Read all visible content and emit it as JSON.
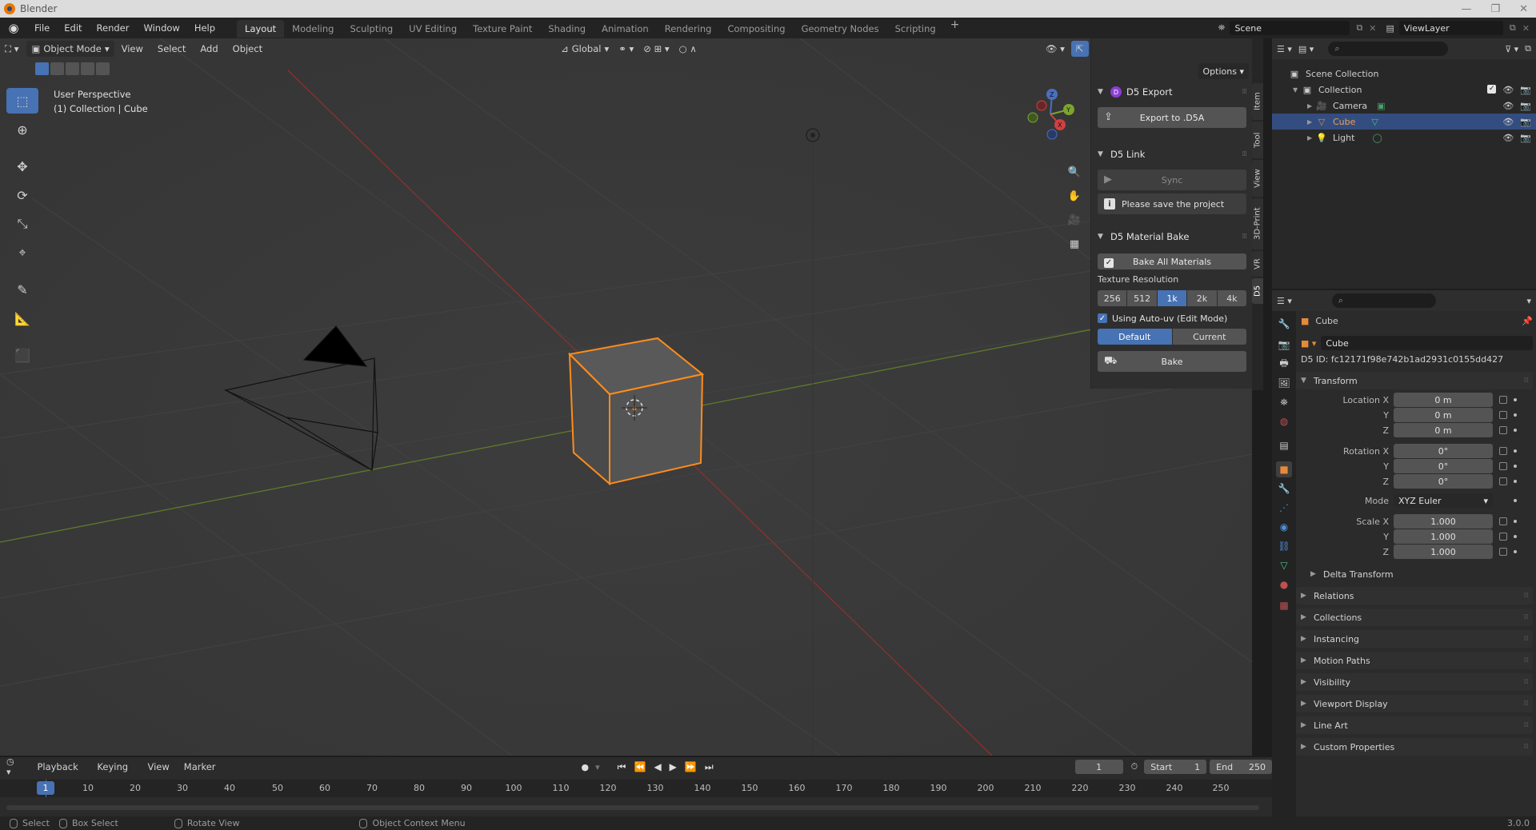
{
  "window": {
    "title": "Blender"
  },
  "menubar": {
    "menus": [
      "File",
      "Edit",
      "Render",
      "Window",
      "Help"
    ],
    "workspaces": [
      "Layout",
      "Modeling",
      "Sculpting",
      "UV Editing",
      "Texture Paint",
      "Shading",
      "Animation",
      "Rendering",
      "Compositing",
      "Geometry Nodes",
      "Scripting"
    ],
    "active_workspace": "Layout",
    "scene": "Scene",
    "view_layer": "ViewLayer"
  },
  "viewport": {
    "mode": "Object Mode",
    "menus": [
      "View",
      "Select",
      "Add",
      "Object"
    ],
    "orientation": "Global",
    "perspective_label": "User Perspective",
    "collection_label": "(1) Collection | Cube",
    "options_label": "Options"
  },
  "d5": {
    "export": {
      "title": "D5 Export",
      "button": "Export to .D5A"
    },
    "link": {
      "title": "D5 Link",
      "sync": "Sync",
      "info": "Please save the project"
    },
    "bake": {
      "title": "D5 Material Bake",
      "bake_all": "Bake All Materials",
      "tex_res_label": "Texture Resolution",
      "resolutions": [
        "256",
        "512",
        "1k",
        "2k",
        "4k"
      ],
      "active_resolution": "1k",
      "auto_uv": "Using Auto-uv (Edit Mode)",
      "default": "Default",
      "current": "Current",
      "bake": "Bake"
    },
    "tabs": [
      "Item",
      "Tool",
      "View",
      "3D-Print",
      "VR",
      "D5"
    ]
  },
  "outliner": {
    "root": "Scene Collection",
    "collection": "Collection",
    "items": [
      {
        "name": "Camera"
      },
      {
        "name": "Cube"
      },
      {
        "name": "Light"
      }
    ]
  },
  "properties": {
    "object_name": "Cube",
    "name_field": "Cube",
    "d5_id": "D5 ID: fc12171f98e742b1ad2931c0155dd427",
    "transform_title": "Transform",
    "location": {
      "label_x": "Location X",
      "label_y": "Y",
      "label_z": "Z",
      "x": "0 m",
      "y": "0 m",
      "z": "0 m"
    },
    "rotation": {
      "label_x": "Rotation X",
      "label_y": "Y",
      "label_z": "Z",
      "x": "0°",
      "y": "0°",
      "z": "0°"
    },
    "mode_label": "Mode",
    "mode": "XYZ Euler",
    "scale": {
      "label_x": "Scale X",
      "label_y": "Y",
      "label_z": "Z",
      "x": "1.000",
      "y": "1.000",
      "z": "1.000"
    },
    "delta_transform": "Delta Transform",
    "panels": [
      "Relations",
      "Collections",
      "Instancing",
      "Motion Paths",
      "Visibility",
      "Viewport Display",
      "Line Art",
      "Custom Properties"
    ]
  },
  "timeline": {
    "menus": [
      "Playback",
      "Keying",
      "View",
      "Marker"
    ],
    "current_frame": "1",
    "start_label": "Start",
    "start": "1",
    "end_label": "End",
    "end": "250",
    "ruler": [
      "1",
      "10",
      "20",
      "30",
      "40",
      "50",
      "60",
      "70",
      "80",
      "90",
      "100",
      "110",
      "120",
      "130",
      "140",
      "150",
      "160",
      "170",
      "180",
      "190",
      "200",
      "210",
      "220",
      "230",
      "240",
      "250"
    ]
  },
  "statusbar": {
    "select": "Select",
    "box_select": "Box Select",
    "rotate_view": "Rotate View",
    "context_menu": "Object Context Menu",
    "version": "3.0.0"
  },
  "colors": {
    "accent": "#4772b3",
    "selection_orange": "#ff8c1a",
    "x_axis": "#a83434",
    "y_axis": "#6b8c2a"
  }
}
